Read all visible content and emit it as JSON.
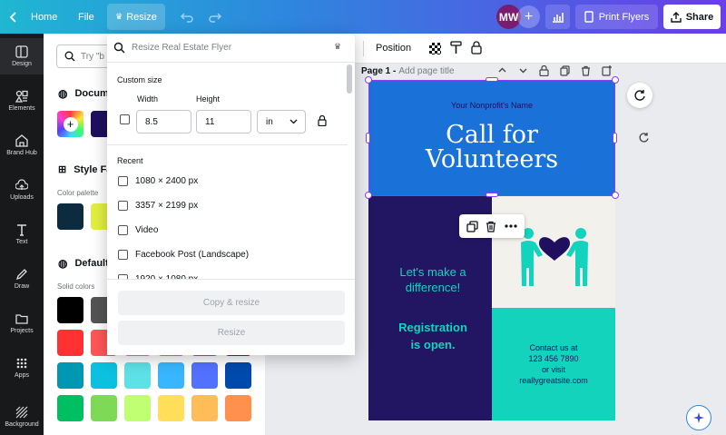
{
  "topbar": {
    "home_label": "Home",
    "file_label": "File",
    "resize_label": "Resize",
    "avatar_initials": "MW",
    "print_label": "Print Flyers",
    "share_label": "Share"
  },
  "nav": {
    "design": "Design",
    "elements": "Elements",
    "brandhub": "Brand Hub",
    "uploads": "Uploads",
    "text": "Text",
    "draw": "Draw",
    "projects": "Projects",
    "apps": "Apps",
    "background": "Background"
  },
  "panel": {
    "search_placeholder": "Try \"b",
    "doc_colors_title": "Docum",
    "style_title": "Style Fa",
    "color_palette_label": "Color palette",
    "default_title": "Default",
    "solid_colors_label": "Solid colors",
    "palette": [
      "#0d2b3e",
      "#e2f043"
    ],
    "doc_colors": [
      "#1f0f5e"
    ],
    "solid_colors": [
      [
        "#000000",
        "#545454",
        "#737373",
        "#a6a6a6",
        "#d9d9d9",
        "#ffffff"
      ],
      [
        "#ff3131",
        "#ff5757",
        "#ff66c4",
        "#cb6ce6",
        "#8c52ff",
        "#5e17eb"
      ],
      [
        "#0097b2",
        "#0cc0df",
        "#5ce1e6",
        "#38b6ff",
        "#5271ff",
        "#004aad"
      ],
      [
        "#00bf63",
        "#7ed957",
        "#c1ff72",
        "#ffde59",
        "#ffbd59",
        "#ff914d"
      ]
    ]
  },
  "resize_dropdown": {
    "search_placeholder": "Resize Real Estate Flyer",
    "custom_size_label": "Custom size",
    "width_label": "Width",
    "height_label": "Height",
    "width_value": "8.5",
    "height_value": "11",
    "unit_value": "in",
    "recent_label": "Recent",
    "recent_items": [
      "1080 × 2400 px",
      "3357 × 2199 px",
      "Video",
      "Facebook Post (Landscape)",
      "1920 × 1080 px"
    ],
    "copy_resize_label": "Copy & resize",
    "resize_button_label": "Resize"
  },
  "context_toolbar": {
    "position_label": "Position"
  },
  "page_header": {
    "page_label": "Page 1 -",
    "title_placeholder": "Add page title"
  },
  "flyer": {
    "org_name": "Your Nonprofit's Name",
    "headline_1": "Call for",
    "headline_2": "Volunteers",
    "tagline_1": "Let's make a",
    "tagline_2": "difference!",
    "registration_1": "Registration",
    "registration_2": "is open.",
    "contact_1": "Contact us at",
    "contact_2": "123 456 7890",
    "contact_3": "or visit",
    "contact_4": "reallygreatsite.com"
  },
  "colors": {
    "flyer_blue": "#1a72d9",
    "flyer_navy": "#221663",
    "flyer_teal": "#14d3bd",
    "flyer_cream": "#f3f1ec",
    "accent_purple": "#8b3dff"
  }
}
